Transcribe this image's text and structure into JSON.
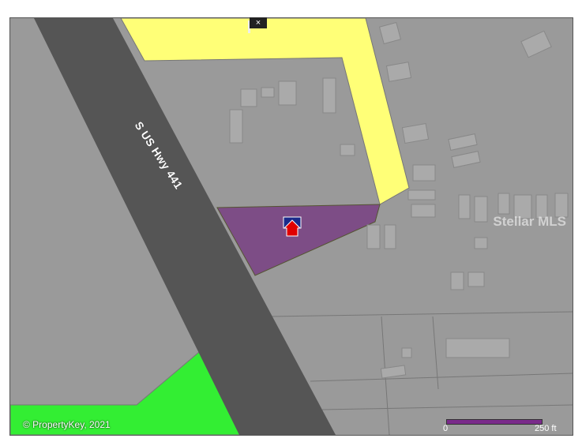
{
  "map": {
    "road_label": "S US Hwy 441",
    "copyright": "© PropertyKey, 2021",
    "watermark": "Stellar MLS",
    "scale": {
      "start": "0",
      "end": "250 ft"
    },
    "close_symbol": "×",
    "icons": [
      "close-icon",
      "home-marker-icon"
    ],
    "colors": {
      "background": "#9a9a9a",
      "road": "#555555",
      "commercial_zone": "#ffff77",
      "green_zone": "#33ee33",
      "subject_parcel": "#7d4d86",
      "marker": "#e00000"
    }
  }
}
